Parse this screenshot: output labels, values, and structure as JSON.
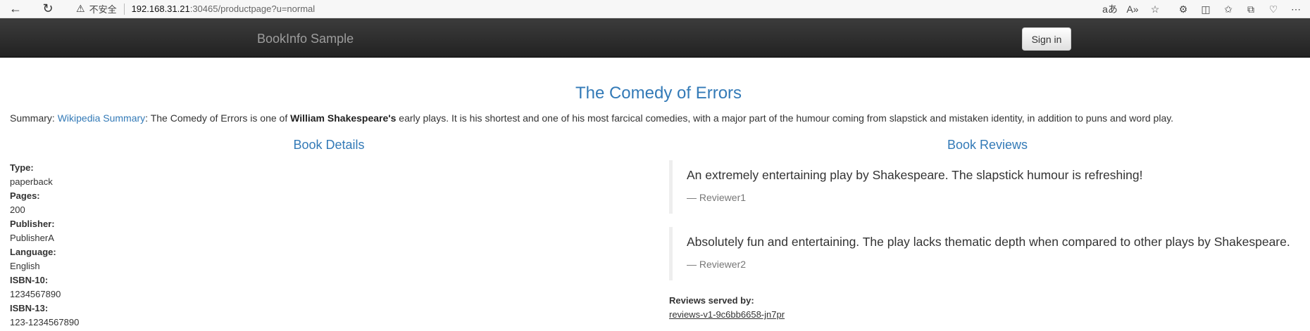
{
  "browser": {
    "back_icon": "←",
    "reload_icon": "↻",
    "warning_icon": "⚠",
    "insecure_text": "不安全",
    "url_host": "192.168.31.21",
    "url_rest": ":30465/productpage?u=normal",
    "toolbar_icons": [
      "aあ",
      "A»",
      "☆",
      "⚙",
      "◫",
      "✩",
      "⧉",
      "♡",
      "⋯"
    ]
  },
  "navbar": {
    "brand": "BookInfo Sample",
    "signin_label": "Sign in"
  },
  "book": {
    "title": "The Comedy of Errors",
    "summary_prefix": "Summary: ",
    "summary_link": "Wikipedia Summary",
    "summary_text_1": ": The Comedy of Errors is one of ",
    "summary_bold": "William Shakespeare's",
    "summary_text_2": " early plays. It is his shortest and one of his most farcical comedies, with a major part of the humour coming from slapstick and mistaken identity, in addition to puns and word play."
  },
  "details": {
    "title": "Book Details",
    "fields": [
      {
        "label": "Type:",
        "value": "paperback"
      },
      {
        "label": "Pages:",
        "value": "200"
      },
      {
        "label": "Publisher:",
        "value": "PublisherA"
      },
      {
        "label": "Language:",
        "value": "English"
      },
      {
        "label": "ISBN-10:",
        "value": "1234567890"
      },
      {
        "label": "ISBN-13:",
        "value": "123-1234567890"
      }
    ]
  },
  "reviews": {
    "title": "Book Reviews",
    "items": [
      {
        "text": "An extremely entertaining play by Shakespeare. The slapstick humour is refreshing!",
        "author": "— Reviewer1"
      },
      {
        "text": "Absolutely fun and entertaining. The play lacks thematic depth when compared to other plays by Shakespeare.",
        "author": "— Reviewer2"
      }
    ],
    "served_by_label": "Reviews served by:",
    "served_by_value": "reviews-v1-9c6bb6658-jn7pr"
  }
}
